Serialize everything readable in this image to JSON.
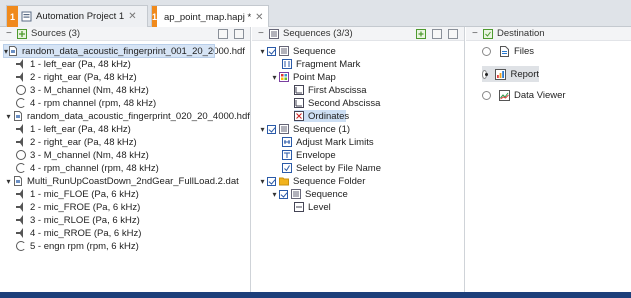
{
  "tabs": [
    {
      "num": "1",
      "label": "Automation Project 1",
      "close": "✕"
    },
    {
      "num": "1",
      "label": "ap_point_map.hapj *",
      "close": "✕"
    }
  ],
  "sources": {
    "title": "Sources (3)",
    "files": [
      {
        "name": "random_data_acoustic_fingerprint_001_20_2000.hdf",
        "channels": [
          {
            "label": "1 - left_ear (Pa, 48 kHz)",
            "icon": "audio-channel-icon"
          },
          {
            "label": "2 - right_ear (Pa, 48 kHz)",
            "icon": "audio-channel-icon"
          },
          {
            "label": "3 - M_channel (Nm, 48 kHz)",
            "icon": "torque-channel-icon"
          },
          {
            "label": "4 - rpm channel (rpm, 48 kHz)",
            "icon": "rpm-channel-icon"
          }
        ]
      },
      {
        "name": "random_data_acoustic_fingerprint_020_20_4000.hdf",
        "channels": [
          {
            "label": "1 - left_ear (Pa, 48 kHz)",
            "icon": "audio-channel-icon"
          },
          {
            "label": "2 - right_ear (Pa, 48 kHz)",
            "icon": "audio-channel-icon"
          },
          {
            "label": "3 - M_channel (Nm, 48 kHz)",
            "icon": "torque-channel-icon"
          },
          {
            "label": "4 - rpm_channel (rpm, 48 kHz)",
            "icon": "rpm-channel-icon"
          }
        ]
      },
      {
        "name": "Multi_RunUpCoastDown_2ndGear_FullLoad.2.dat",
        "channels": [
          {
            "label": "1 - mic_FLOE (Pa, 6 kHz)",
            "icon": "audio-channel-icon"
          },
          {
            "label": "2 - mic_FROE (Pa, 6 kHz)",
            "icon": "audio-channel-icon"
          },
          {
            "label": "3 - mic_RLOE (Pa, 6 kHz)",
            "icon": "audio-channel-icon"
          },
          {
            "label": "4 - mic_RROE (Pa, 6 kHz)",
            "icon": "audio-channel-icon"
          },
          {
            "label": "5 - engn rpm (rpm, 6 kHz)",
            "icon": "rpm-channel-icon"
          }
        ]
      }
    ]
  },
  "sequences": {
    "title": "Sequences (3/3)",
    "items": [
      {
        "label": "Sequence"
      },
      {
        "label": "Fragment Mark"
      },
      {
        "label": "Point Map"
      },
      {
        "label": "First Abscissa"
      },
      {
        "label": "Second Abscissa"
      },
      {
        "label": "Ordinates"
      },
      {
        "label": "Sequence (1)"
      },
      {
        "label": "Adjust Mark Limits"
      },
      {
        "label": "Envelope"
      },
      {
        "label": "Select by File Name"
      },
      {
        "label": "Sequence Folder"
      },
      {
        "label": "Sequence"
      },
      {
        "label": "Level"
      }
    ]
  },
  "destination": {
    "title": "Destination",
    "options": [
      {
        "label": "Files",
        "selected": false
      },
      {
        "label": "Report",
        "selected": true
      },
      {
        "label": "Data Viewer",
        "selected": false
      }
    ]
  },
  "colors": {
    "accent_orange": "#f08a1c",
    "selection": "#d6e4f5",
    "status_bar": "#1d3f7a"
  }
}
